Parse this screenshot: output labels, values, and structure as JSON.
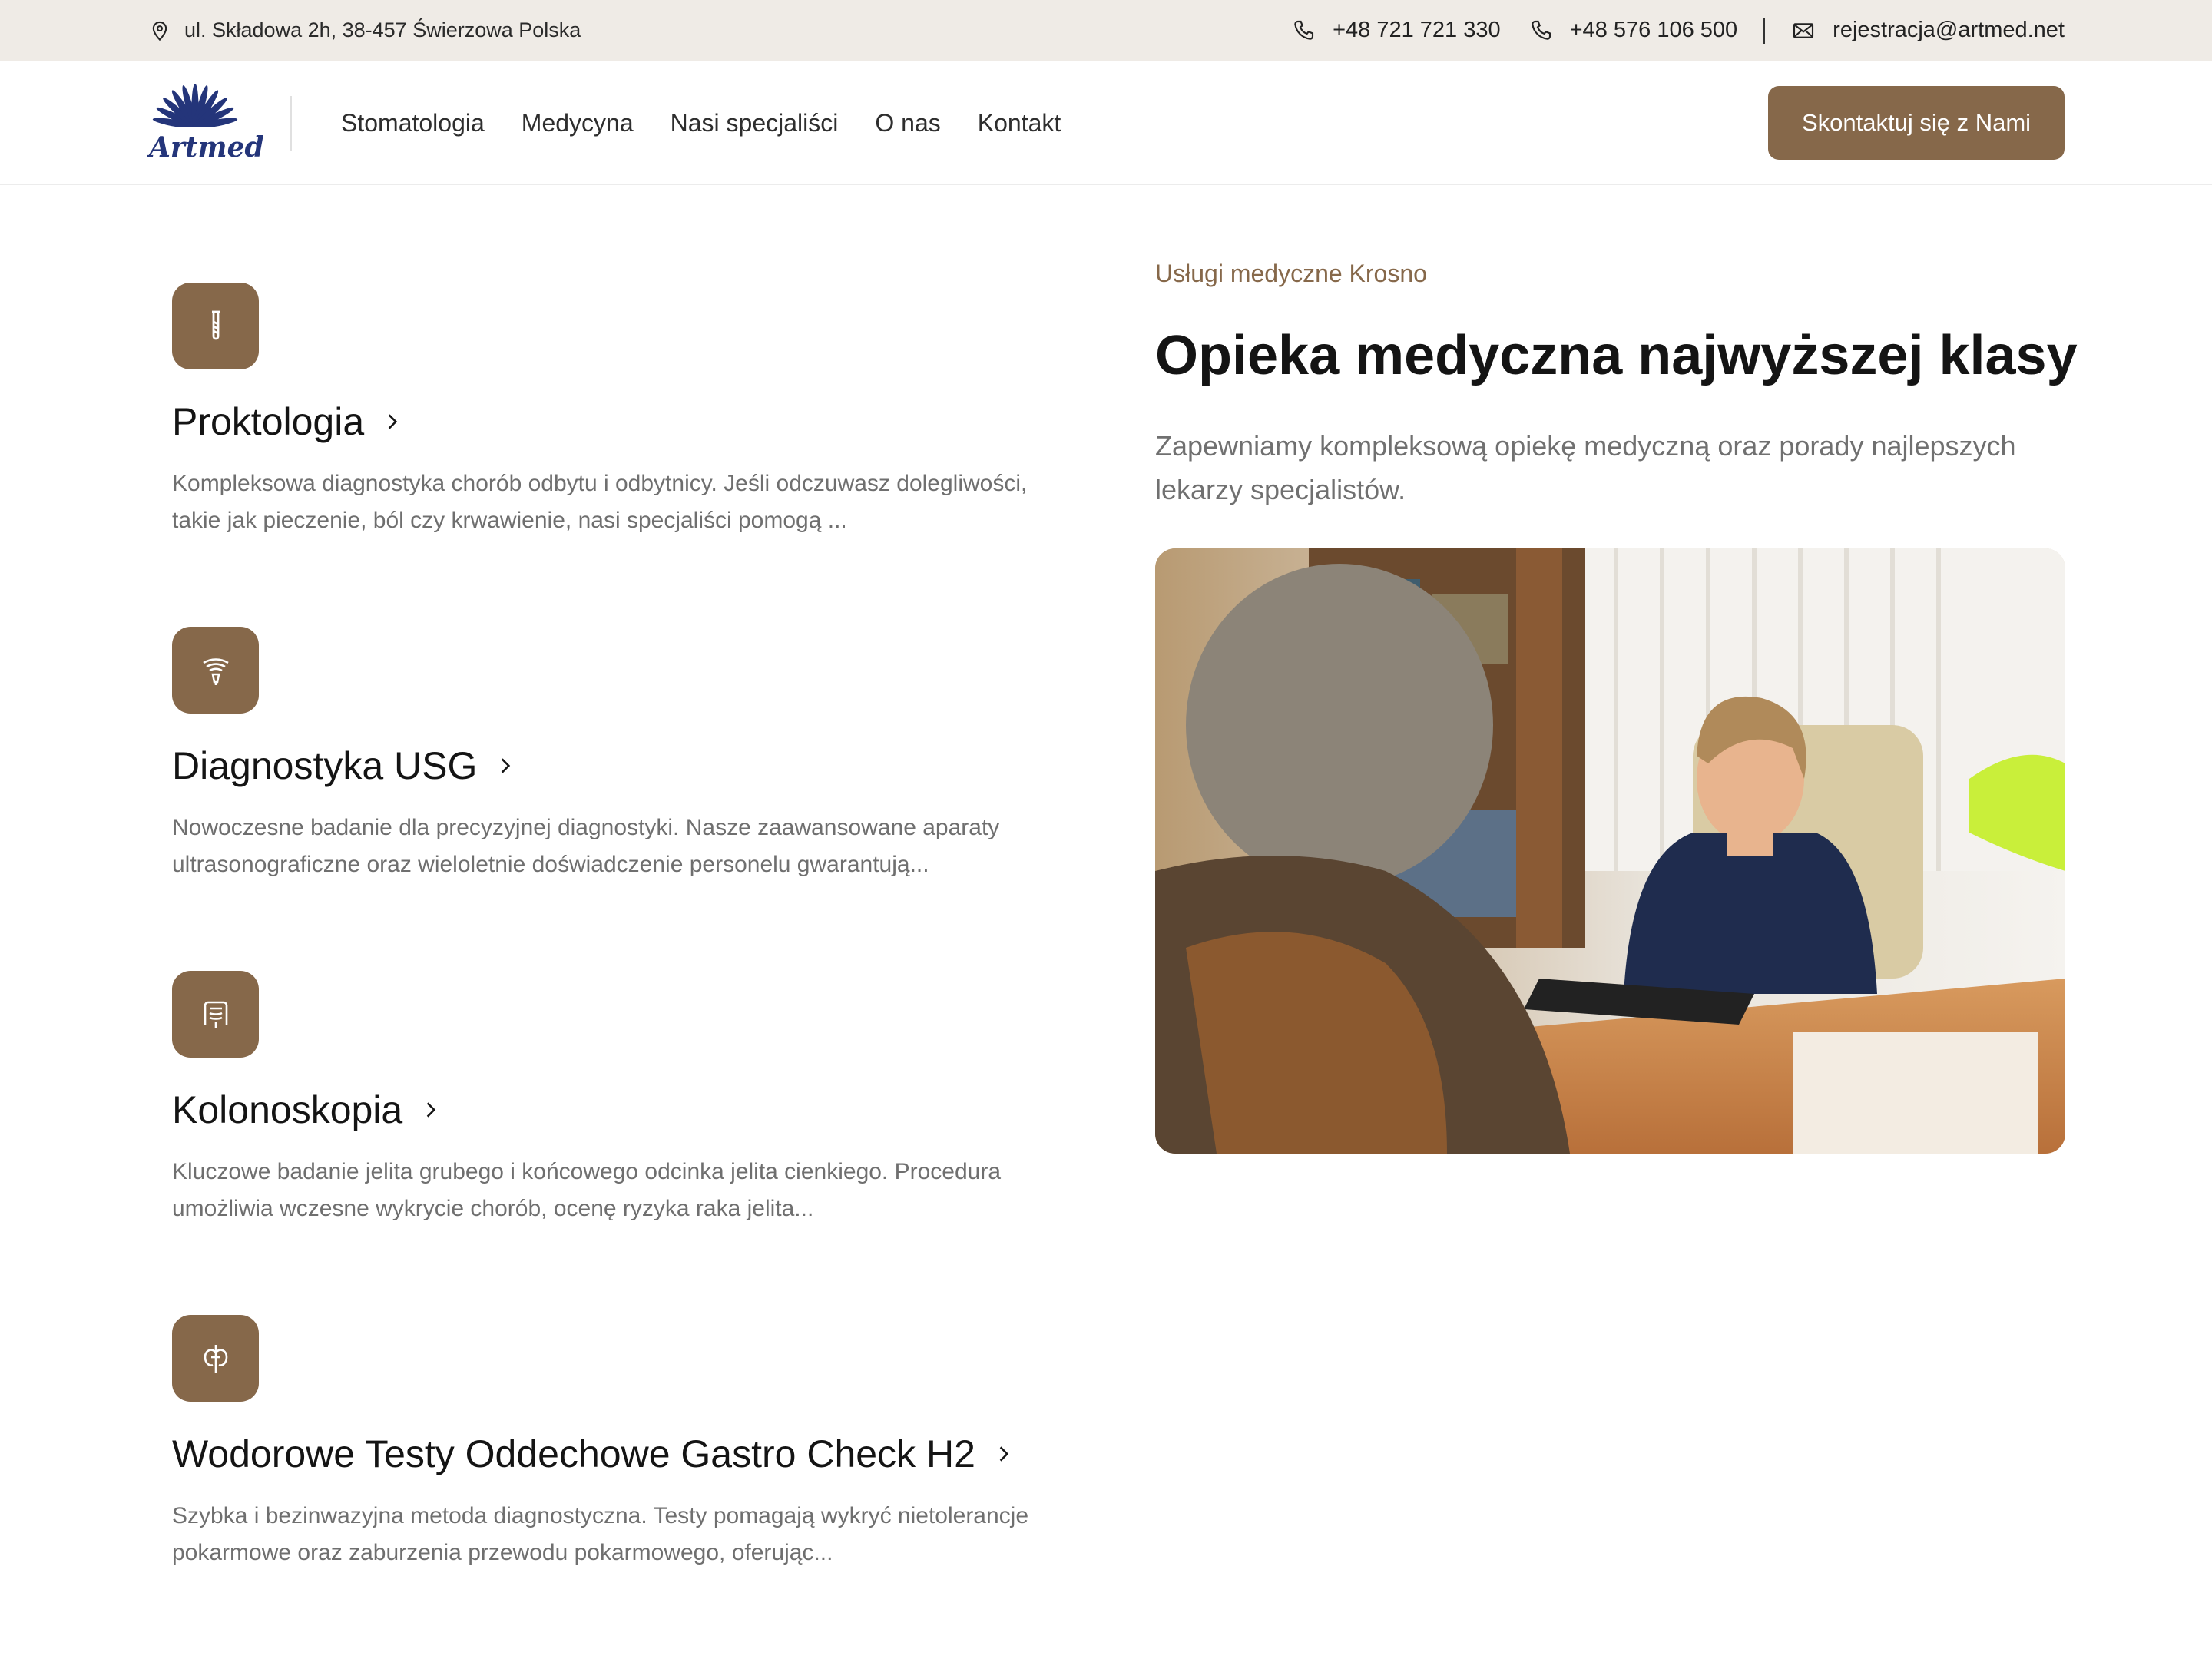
{
  "topbar": {
    "address": "ul. Składowa 2h, 38-457 Świerzowa Polska",
    "phone1": "+48 721 721 330",
    "phone2": "+48 576 106 500",
    "email": "rejestracja@artmed.net",
    "icons": [
      "map-pin-icon",
      "phone-icon",
      "phone-icon",
      "mail-icon"
    ]
  },
  "header": {
    "logo_text": "Artmed",
    "nav": [
      "Stomatologia",
      "Medycyna",
      "Nasi specjaliści",
      "O nas",
      "Kontakt"
    ],
    "cta": "Skontaktuj się z Nami"
  },
  "services": [
    {
      "title": "Proktologia",
      "icon": "test-tube-icon",
      "description": "Kompleksowa diagnostyka chorób odbytu i odbytnicy. Jeśli odczuwasz dolegliwości, takie jak pieczenie, ból czy krwawienie, nasi specjaliści pomogą ..."
    },
    {
      "title": "Diagnostyka USG",
      "icon": "ultrasound-icon",
      "description": "Nowoczesne badanie dla precyzyjnej diagnostyki. Nasze zaawansowane aparaty ultrasonograficzne oraz wieloletnie doświadczenie personelu gwarantują..."
    },
    {
      "title": "Kolonoskopia",
      "icon": "intestine-icon",
      "description": "Kluczowe badanie jelita grubego i końcowego odcinka jelita cienkiego. Procedura umożliwia wczesne wykrycie chorób, ocenę ryzyka raka jelita..."
    },
    {
      "title": "Wodorowe Testy Oddechowe Gastro Check H2",
      "icon": "breath-test-icon",
      "description": "Szybka i bezinwazyjna metoda diagnostyczna. Testy pomagają wykryć nietolerancje pokarmowe oraz zaburzenia przewodu pokarmowego, oferując..."
    }
  ],
  "hero": {
    "kicker": "Usługi medyczne Krosno",
    "title": "Opieka medyczna najwyższej klasy",
    "subtitle": "Zapewniamy kompleksową opiekę medyczną oraz porady najlepszych lekarzy specjalistów."
  },
  "colors": {
    "accent": "#86684a",
    "topbar_bg": "#efebe6",
    "logo_blue": "#24357a"
  }
}
